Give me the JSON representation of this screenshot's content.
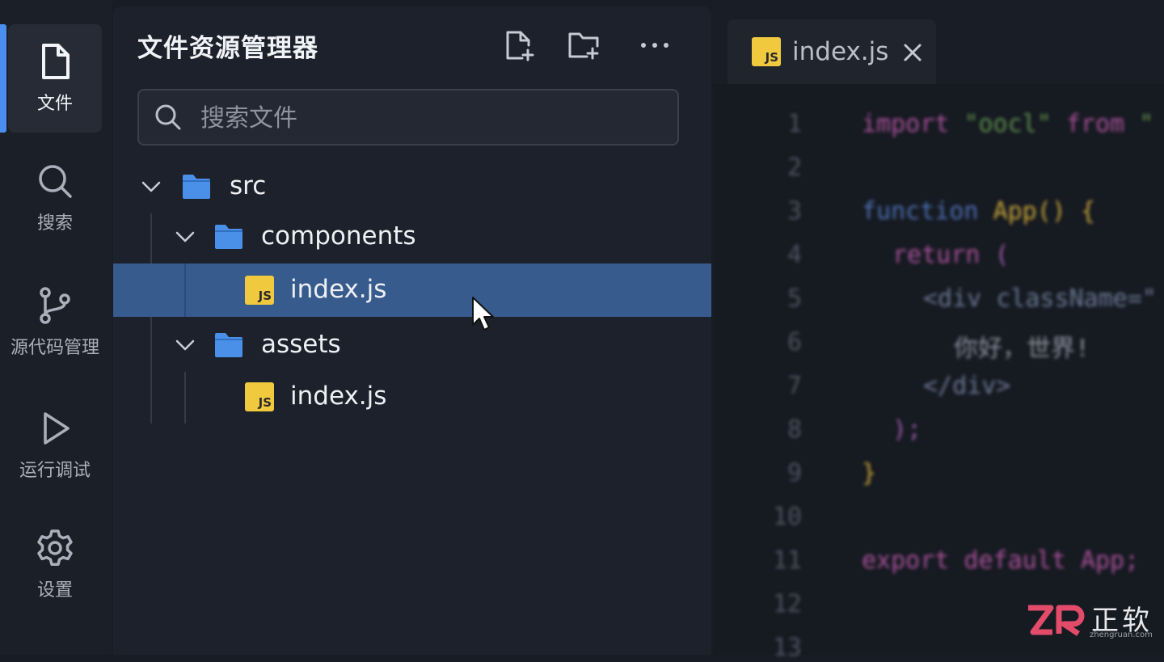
{
  "activity_bar": {
    "items": [
      {
        "label": "文件",
        "icon": "file-icon",
        "active": true
      },
      {
        "label": "搜索",
        "icon": "search-icon",
        "active": false
      },
      {
        "label": "源代码管理",
        "icon": "source-control-icon",
        "active": false
      },
      {
        "label": "运行调试",
        "icon": "run-debug-icon",
        "active": false
      },
      {
        "label": "设置",
        "icon": "gear-icon",
        "active": false
      }
    ]
  },
  "explorer": {
    "title": "文件资源管理器",
    "tools": [
      "new-file-icon",
      "new-folder-icon",
      "more-icon"
    ],
    "search": {
      "placeholder": "搜索文件",
      "value": ""
    },
    "tree": [
      {
        "label": "src",
        "type": "folder",
        "expanded": true
      },
      {
        "label": "components",
        "type": "folder",
        "expanded": true
      },
      {
        "label": "index.js",
        "type": "file",
        "selected": true
      },
      {
        "label": "assets",
        "type": "folder",
        "expanded": true
      },
      {
        "label": "index.js",
        "type": "file",
        "selected": false
      }
    ]
  },
  "editor": {
    "tab": {
      "label": "index.js",
      "icon_text": "JS"
    },
    "line_numbers": [
      "1",
      "2",
      "3",
      "4",
      "5",
      "6",
      "7",
      "8",
      "9",
      "10",
      "11",
      "12",
      "13"
    ],
    "code": {
      "l1_import": "import",
      "l1_str": "\"oocl\"",
      "l1_from": "from",
      "l1_tail": "\"",
      "l3_function": "function",
      "l3_name": "App()",
      "l3_brace": "{",
      "l4_return": "return",
      "l4_paren": "(",
      "l5_open": "<div",
      "l5_attr": "className=\"",
      "l6_text": "你好，世界!",
      "l7_close": "</div>",
      "l8_end": ");",
      "l9_brace": "}",
      "l11_export": "export default",
      "l11_app": "App;"
    }
  },
  "brand": {
    "name": "正软",
    "site": "zhengruan.com",
    "mark": "ZR"
  },
  "colors": {
    "accent": "#4a8ff0",
    "selection": "#385b8e",
    "js_badge": "#f0c93e",
    "folder": "#4a90e8"
  }
}
